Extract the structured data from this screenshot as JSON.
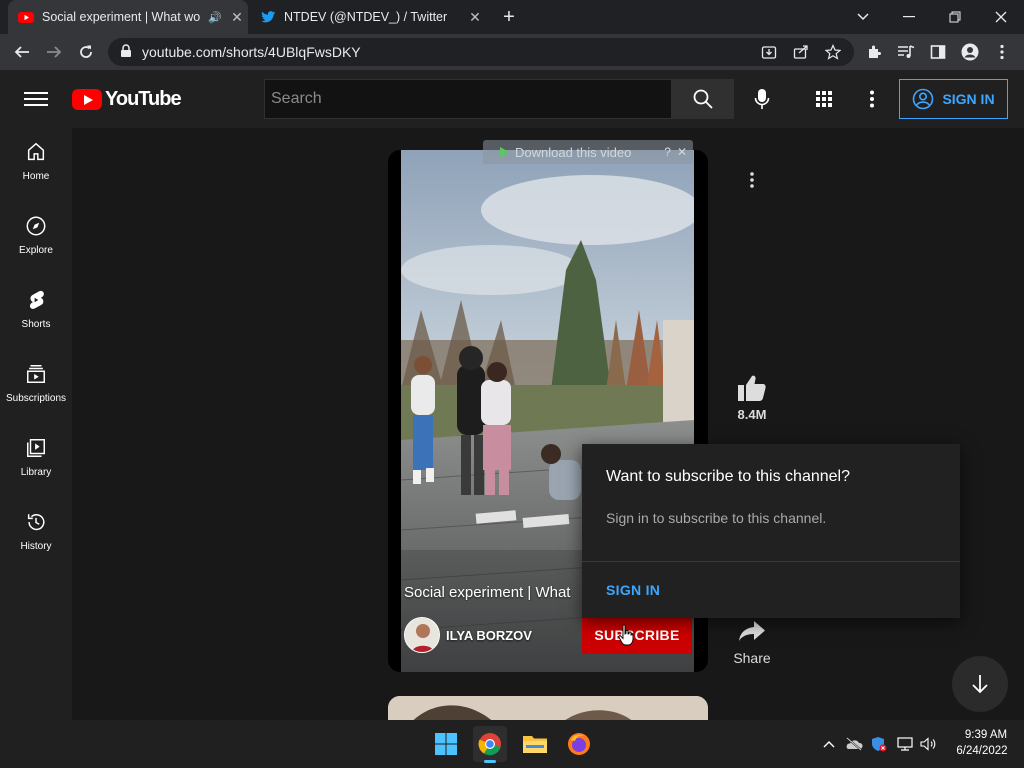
{
  "browser": {
    "tabs": [
      {
        "title": "Social experiment | What wo",
        "close": "✕"
      },
      {
        "title": "NTDEV (@NTDEV_) / Twitter",
        "close": "✕"
      }
    ],
    "new_tab": "+",
    "url": "youtube.com/shorts/4UBlqFwsDKY"
  },
  "youtube": {
    "logo_text": "YouTube",
    "search_placeholder": "Search",
    "sign_in_top": "SIGN IN",
    "guide": [
      {
        "label": "Home"
      },
      {
        "label": "Explore"
      },
      {
        "label": "Shorts"
      },
      {
        "label": "Subscriptions"
      },
      {
        "label": "Library"
      },
      {
        "label": "History"
      }
    ]
  },
  "short": {
    "download_bar": "Download this video",
    "title": "Social experiment | What",
    "channel": "ILYA BORZOV",
    "subscribe": "SUBSCRIBE",
    "likes": "8.4M",
    "share": "Share"
  },
  "popup": {
    "title": "Want to subscribe to this channel?",
    "body": "Sign in to subscribe to this channel.",
    "sign_in": "SIGN IN"
  },
  "taskbar": {
    "time": "9:39 AM",
    "date": "6/24/2022"
  },
  "colors": {
    "youtube_red": "#ff0000",
    "subscribe_red": "#cc0000",
    "link_blue": "#3ea6ff"
  }
}
